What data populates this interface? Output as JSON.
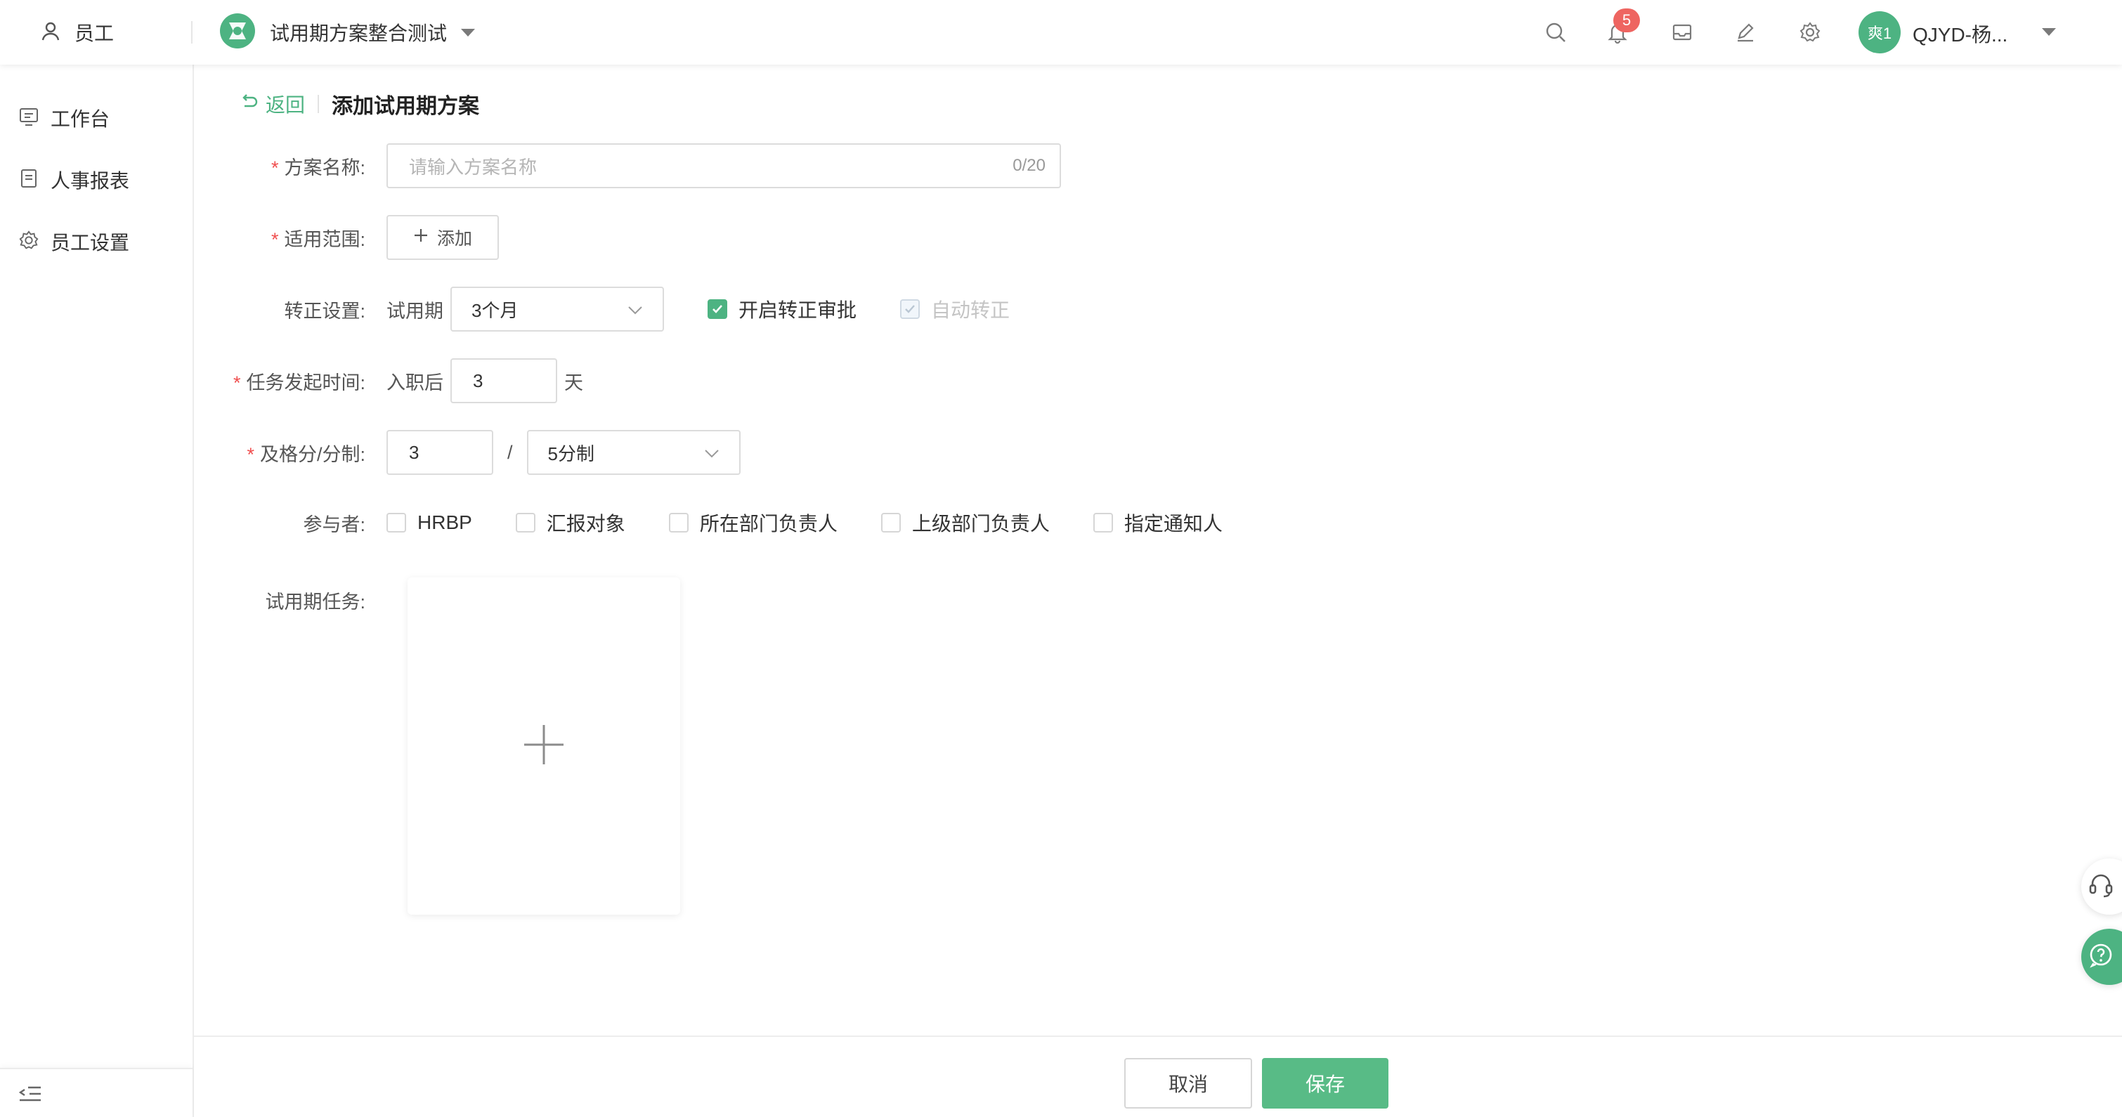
{
  "header": {
    "module_label": "员工",
    "project_name": "试用期方案整合测试",
    "notification_count": "5",
    "avatar_text": "爽1",
    "username": "QJYD-杨..."
  },
  "sidebar": {
    "items": [
      {
        "label": "工作台",
        "icon": "workbench-icon"
      },
      {
        "label": "人事报表",
        "icon": "report-icon"
      },
      {
        "label": "员工设置",
        "icon": "gear-icon"
      }
    ]
  },
  "breadcrumb": {
    "back_label": "返回",
    "title": "添加试用期方案"
  },
  "form": {
    "plan_name": {
      "label": "方案名称:",
      "required": "*",
      "placeholder": "请输入方案名称",
      "counter": "0/20"
    },
    "scope": {
      "label": "适用范围:",
      "required": "*",
      "add_label": "添加"
    },
    "regularization": {
      "label": "转正设置:",
      "prefix": "试用期",
      "period_value": "3个月",
      "approval_label": "开启转正审批",
      "approval_checked": true,
      "auto_label": "自动转正",
      "auto_checked": true,
      "auto_disabled": true
    },
    "task_start": {
      "label": "任务发起时间:",
      "required": "*",
      "prefix": "入职后",
      "value": "3",
      "suffix": "天"
    },
    "passing_score": {
      "label": "及格分/分制:",
      "required": "*",
      "value": "3",
      "separator": "/",
      "scale_value": "5分制"
    },
    "participants": {
      "label": "参与者:",
      "options": [
        {
          "label": "HRBP",
          "checked": false
        },
        {
          "label": "汇报对象",
          "checked": false
        },
        {
          "label": "所在部门负责人",
          "checked": false
        },
        {
          "label": "上级部门负责人",
          "checked": false
        },
        {
          "label": "指定通知人",
          "checked": false
        }
      ]
    },
    "tasks": {
      "label": "试用期任务:"
    }
  },
  "footer": {
    "cancel_label": "取消",
    "save_label": "保存"
  },
  "colors": {
    "accent": "#4db382",
    "badge": "#ee6561",
    "required": "#f05050"
  }
}
